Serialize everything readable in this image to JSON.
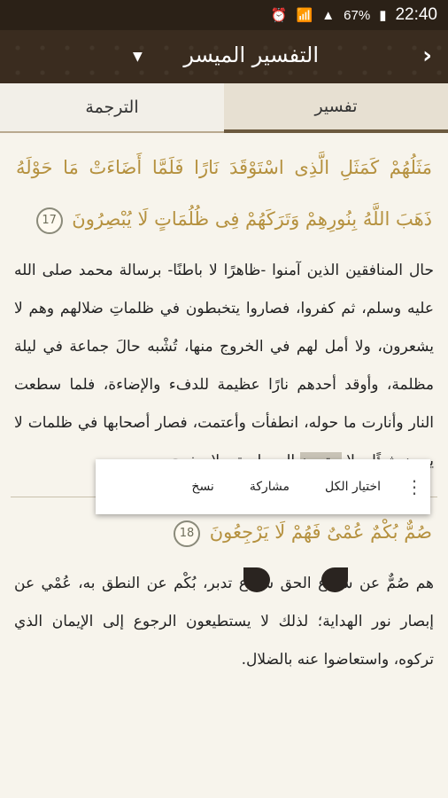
{
  "status_bar": {
    "battery": "67%",
    "time": "22:40"
  },
  "app_bar": {
    "title": "التفسير الميسر",
    "dropdown_icon": "▼",
    "back_icon": "›"
  },
  "tabs": [
    {
      "label": "تفسير",
      "active": true
    },
    {
      "label": "الترجمة",
      "active": false
    }
  ],
  "verses": [
    {
      "text": "مَثَلُهُمْ كَمَثَلِ الَّذِى اسْتَوْقَدَ نَارًا فَلَمَّا أَضَاءَتْ مَا حَوْلَهُ ذَهَبَ اللَّهُ بِنُورِهِمْ وَتَرَكَهُمْ فِى ظُلُمَاتٍ لَا يُبْصِرُونَ",
      "number": "17"
    },
    {
      "text": "صُمٌّ بُكْمٌ عُمْىٌ فَهُمْ لَا يَرْجِعُونَ",
      "number": "18"
    }
  ],
  "tafsir_1_before": "حال المنافقين الذين آمنوا -ظاهرًا لا باطنًا- برسالة محمد صلى الله عليه وسلم، ثم كفروا، فصاروا يتخبطون في ظلماتِ ضلالهم وهم لا يشعرون، ولا أمل لهم في الخروج منها، تُشْبه حالَ جماعة في ليلة مظلمة، وأوقد أحدهم نارًا عظيمة للدفء والإضاءة، فلما سطعت النار وأنارت ما حوله، انطفأت وأعتمت، فصار أصحابها في ظلمات لا يرون شيئًا، ولا",
  "tafsir_1_selected": "يهتدون",
  "tafsir_1_after": "إلى طريق ولا مخرج.",
  "tafsir_2": "هم صُمٌّ عن سماع الحق سماع تدبر، بُكْم عن النطق به، عُمْي عن إبصار نور الهداية؛ لذلك لا يستطيعون الرجوع إلى الإيمان الذي تركوه، واستعاضوا عنه بالضلال.",
  "context_menu": {
    "select_all": "اختيار الكل",
    "share": "مشاركة",
    "copy": "نسخ"
  }
}
